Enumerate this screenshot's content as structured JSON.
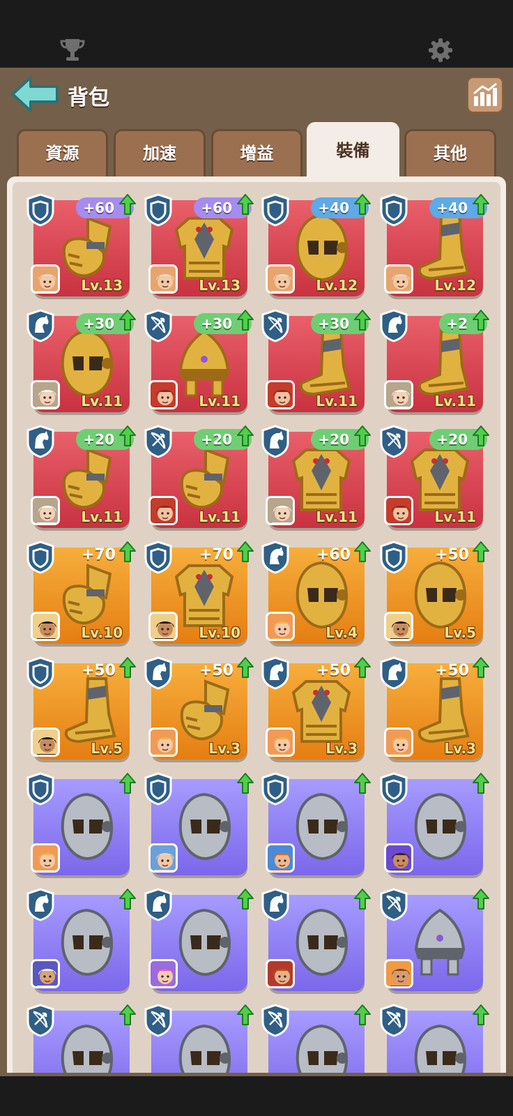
{
  "header": {
    "title": "背包"
  },
  "tabs": [
    {
      "label": "資源",
      "active": false
    },
    {
      "label": "加速",
      "active": false
    },
    {
      "label": "增益",
      "active": false
    },
    {
      "label": "裝備",
      "active": true
    },
    {
      "label": "其他",
      "active": false
    }
  ],
  "colors": {
    "red": "#d94452",
    "orange": "#f0961f",
    "purple": "#8e7cf5",
    "header": "#74604a",
    "panel": "#f4ece6"
  },
  "items": [
    {
      "type": "shield",
      "bonus": "+60",
      "bonus_style": "purple",
      "level": "Lv.13",
      "bg": "red",
      "equip": "gauntlet",
      "hero": "silver-hair-man"
    },
    {
      "type": "shield",
      "bonus": "+60",
      "bonus_style": "purple",
      "level": "Lv.13",
      "bg": "red",
      "equip": "armor",
      "hero": "silver-hair-man"
    },
    {
      "type": "shield",
      "bonus": "+40",
      "bonus_style": "blue",
      "level": "Lv.12",
      "bg": "red",
      "equip": "helmet",
      "hero": "silver-hair-man"
    },
    {
      "type": "shield",
      "bonus": "+40",
      "bonus_style": "blue",
      "level": "Lv.12",
      "bg": "red",
      "equip": "boot",
      "hero": "silver-hair-man"
    },
    {
      "type": "horse",
      "bonus": "+30",
      "bonus_style": "green",
      "level": "Lv.11",
      "bg": "red",
      "equip": "helmet",
      "hero": "veiled-woman"
    },
    {
      "type": "bow",
      "bonus": "+30",
      "bonus_style": "green",
      "level": "Lv.11",
      "bg": "red",
      "equip": "helmet-dome",
      "hero": "red-hair-man"
    },
    {
      "type": "bow",
      "bonus": "+30",
      "bonus_style": "green",
      "level": "Lv.11",
      "bg": "red",
      "equip": "boot",
      "hero": "red-hair-man"
    },
    {
      "type": "horse",
      "bonus": "+2",
      "bonus_style": "green",
      "level": "Lv.11",
      "bg": "red",
      "equip": "boot",
      "hero": "veiled-woman"
    },
    {
      "type": "horse",
      "bonus": "+20",
      "bonus_style": "green",
      "level": "Lv.11",
      "bg": "red",
      "equip": "gauntlet",
      "hero": "veiled-woman"
    },
    {
      "type": "bow",
      "bonus": "+20",
      "bonus_style": "green",
      "level": "Lv.11",
      "bg": "red",
      "equip": "gauntlet",
      "hero": "red-hair-man"
    },
    {
      "type": "horse",
      "bonus": "+20",
      "bonus_style": "green",
      "level": "Lv.11",
      "bg": "red",
      "equip": "armor",
      "hero": "veiled-woman"
    },
    {
      "type": "bow",
      "bonus": "+20",
      "bonus_style": "green",
      "level": "Lv.11",
      "bg": "red",
      "equip": "armor",
      "hero": "red-hair-man"
    },
    {
      "type": "shield",
      "bonus": "+70",
      "bonus_style": "plain",
      "level": "Lv.10",
      "bg": "orange",
      "equip": "gauntlet",
      "hero": "dark-hair-woman"
    },
    {
      "type": "shield",
      "bonus": "+70",
      "bonus_style": "plain",
      "level": "Lv.10",
      "bg": "orange",
      "equip": "armor",
      "hero": "dark-hair-woman"
    },
    {
      "type": "horse",
      "bonus": "+60",
      "bonus_style": "plain",
      "level": "Lv.4",
      "bg": "orange",
      "equip": "helmet",
      "hero": "blonde-woman"
    },
    {
      "type": "shield",
      "bonus": "+50",
      "bonus_style": "plain",
      "level": "Lv.5",
      "bg": "orange",
      "equip": "helmet",
      "hero": "dark-hair-woman"
    },
    {
      "type": "shield",
      "bonus": "+50",
      "bonus_style": "plain",
      "level": "Lv.5",
      "bg": "orange",
      "equip": "boot",
      "hero": "dark-hair-woman"
    },
    {
      "type": "horse",
      "bonus": "+50",
      "bonus_style": "plain",
      "level": "Lv.3",
      "bg": "orange",
      "equip": "gauntlet",
      "hero": "blonde-woman"
    },
    {
      "type": "horse",
      "bonus": "+50",
      "bonus_style": "plain",
      "level": "Lv.3",
      "bg": "orange",
      "equip": "armor",
      "hero": "blonde-woman"
    },
    {
      "type": "horse",
      "bonus": "+50",
      "bonus_style": "plain",
      "level": "Lv.3",
      "bg": "orange",
      "equip": "boot",
      "hero": "blonde-woman"
    },
    {
      "type": "shield",
      "bonus": "",
      "bonus_style": "plain",
      "level": "",
      "bg": "purple",
      "equip": "helmet-silver",
      "hero": "blonde-woman"
    },
    {
      "type": "shield",
      "bonus": "",
      "bonus_style": "plain",
      "level": "",
      "bg": "purple",
      "equip": "helmet-silver",
      "hero": "bald-man"
    },
    {
      "type": "shield",
      "bonus": "",
      "bonus_style": "plain",
      "level": "",
      "bg": "purple",
      "equip": "helmet-silver",
      "hero": "orange-beard"
    },
    {
      "type": "shield",
      "bonus": "",
      "bonus_style": "plain",
      "level": "",
      "bg": "purple",
      "equip": "helmet-silver",
      "hero": "bearded-man"
    },
    {
      "type": "horse",
      "bonus": "",
      "bonus_style": "plain",
      "level": "",
      "bg": "purple",
      "equip": "helmet-silver",
      "hero": "turban-man"
    },
    {
      "type": "horse",
      "bonus": "",
      "bonus_style": "plain",
      "level": "",
      "bg": "purple",
      "equip": "helmet-silver",
      "hero": "pink-hair-woman"
    },
    {
      "type": "horse",
      "bonus": "",
      "bonus_style": "plain",
      "level": "",
      "bg": "purple",
      "equip": "helmet-silver",
      "hero": "hat-man"
    },
    {
      "type": "bow",
      "bonus": "",
      "bonus_style": "plain",
      "level": "",
      "bg": "purple",
      "equip": "helmet-dome-silver",
      "hero": "cowboy-man"
    },
    {
      "type": "bow",
      "bonus": "",
      "bonus_style": "plain",
      "level": "",
      "bg": "purple",
      "equip": "helmet-silver",
      "hero": ""
    },
    {
      "type": "bow",
      "bonus": "",
      "bonus_style": "plain",
      "level": "",
      "bg": "purple",
      "equip": "helmet-silver",
      "hero": ""
    },
    {
      "type": "bow",
      "bonus": "",
      "bonus_style": "plain",
      "level": "",
      "bg": "purple",
      "equip": "helmet-silver",
      "hero": ""
    },
    {
      "type": "bow",
      "bonus": "",
      "bonus_style": "plain",
      "level": "",
      "bg": "purple",
      "equip": "helmet-silver",
      "hero": ""
    }
  ]
}
